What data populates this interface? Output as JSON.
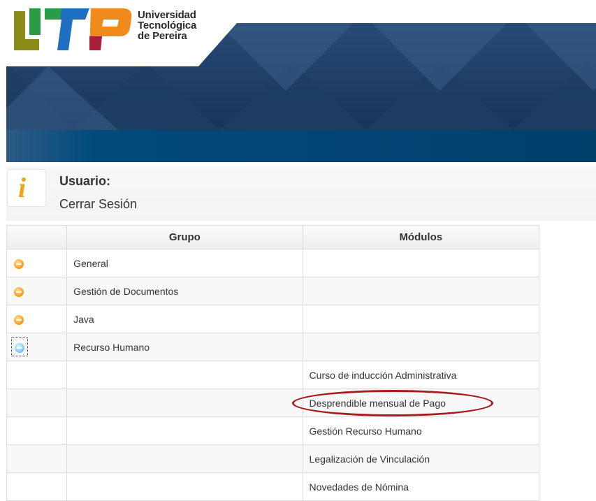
{
  "header": {
    "logo_lines": [
      "Universidad",
      "Tecnológica",
      "de Pereira"
    ],
    "colors": {
      "banner_dark": "#1b3a5e",
      "banner_bar": "#014a7c",
      "logo_olive": "#8b8b1a",
      "logo_green": "#2a9b47",
      "logo_blue": "#1e6fc0",
      "logo_orange": "#f08a1c",
      "logo_red": "#a51f3a"
    }
  },
  "user": {
    "info_icon": "info-icon",
    "label": "Usuario:",
    "logout": "Cerrar Sesión"
  },
  "table": {
    "headers": [
      "",
      "Grupo",
      "Módulos"
    ],
    "groups": [
      {
        "icon": "expand-orange-icon",
        "name": "General"
      },
      {
        "icon": "expand-orange-icon",
        "name": "Gestión de Documentos"
      },
      {
        "icon": "expand-orange-icon",
        "name": "Java"
      },
      {
        "icon": "collapse-blue-icon",
        "name": "Recurso Humano"
      }
    ],
    "modules": [
      "Curso de inducción Administrativa",
      "Desprendible mensual de Pago",
      "Gestión Recurso Humano",
      "Legalización de Vinculación",
      "Novedades de Nómina"
    ],
    "highlighted_module": "Desprendible mensual de Pago",
    "highlight_color": "#a71c1c"
  }
}
